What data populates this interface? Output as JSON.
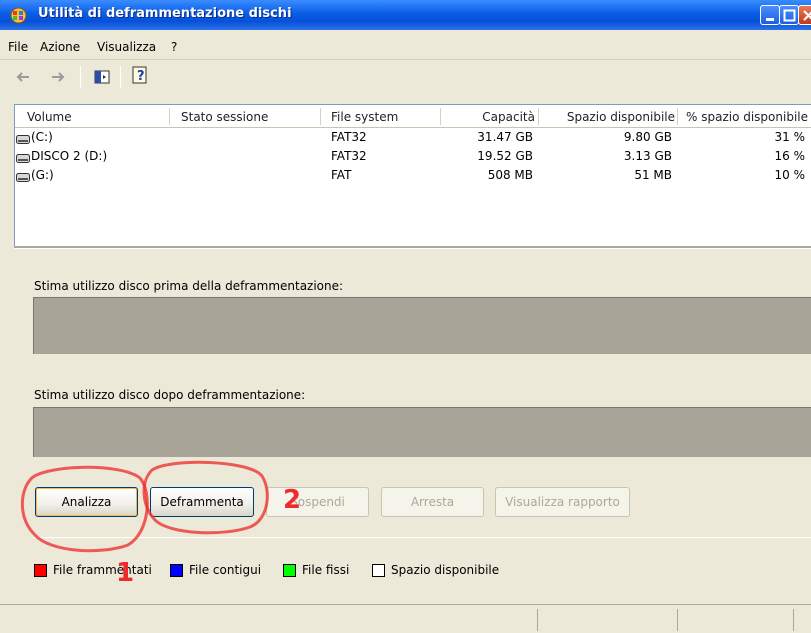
{
  "window": {
    "title": "Utilità di deframmentazione dischi"
  },
  "menu": {
    "items": [
      "File",
      "Azione",
      "Visualizza",
      "?"
    ]
  },
  "list": {
    "columns": [
      "Volume",
      "Stato sessione",
      "File system",
      "Capacità",
      "Spazio disponibile",
      "% spazio disponibile"
    ],
    "rows": [
      {
        "volume": "(C:)",
        "status": "",
        "fs": "FAT32",
        "capacity": "31.47 GB",
        "free": "9.80 GB",
        "pct": "31 %"
      },
      {
        "volume": "DISCO 2 (D:)",
        "status": "",
        "fs": "FAT32",
        "capacity": "19.52 GB",
        "free": "3.13 GB",
        "pct": "16 %"
      },
      {
        "volume": "(G:)",
        "status": "",
        "fs": "FAT",
        "capacity": "508 MB",
        "free": "51 MB",
        "pct": "10 %"
      }
    ]
  },
  "estimate": {
    "before_label": "Stima utilizzo disco prima della deframmentazione:",
    "after_label": "Stima utilizzo disco dopo deframmentazione:"
  },
  "buttons": {
    "analizza": "Analizza",
    "deframmenta": "Deframmenta",
    "sospendi": "Sospendi",
    "arresta": "Arresta",
    "rapporto": "Visualizza rapporto"
  },
  "legend": {
    "items": [
      {
        "label": "File frammentati",
        "color": "#ff0000"
      },
      {
        "label": "File contigui",
        "color": "#0000ff"
      },
      {
        "label": "File fissi",
        "color": "#00ff00"
      },
      {
        "label": "Spazio disponibile",
        "color": "#ffffff"
      }
    ]
  },
  "annotations": {
    "first": "1",
    "second": "2"
  }
}
